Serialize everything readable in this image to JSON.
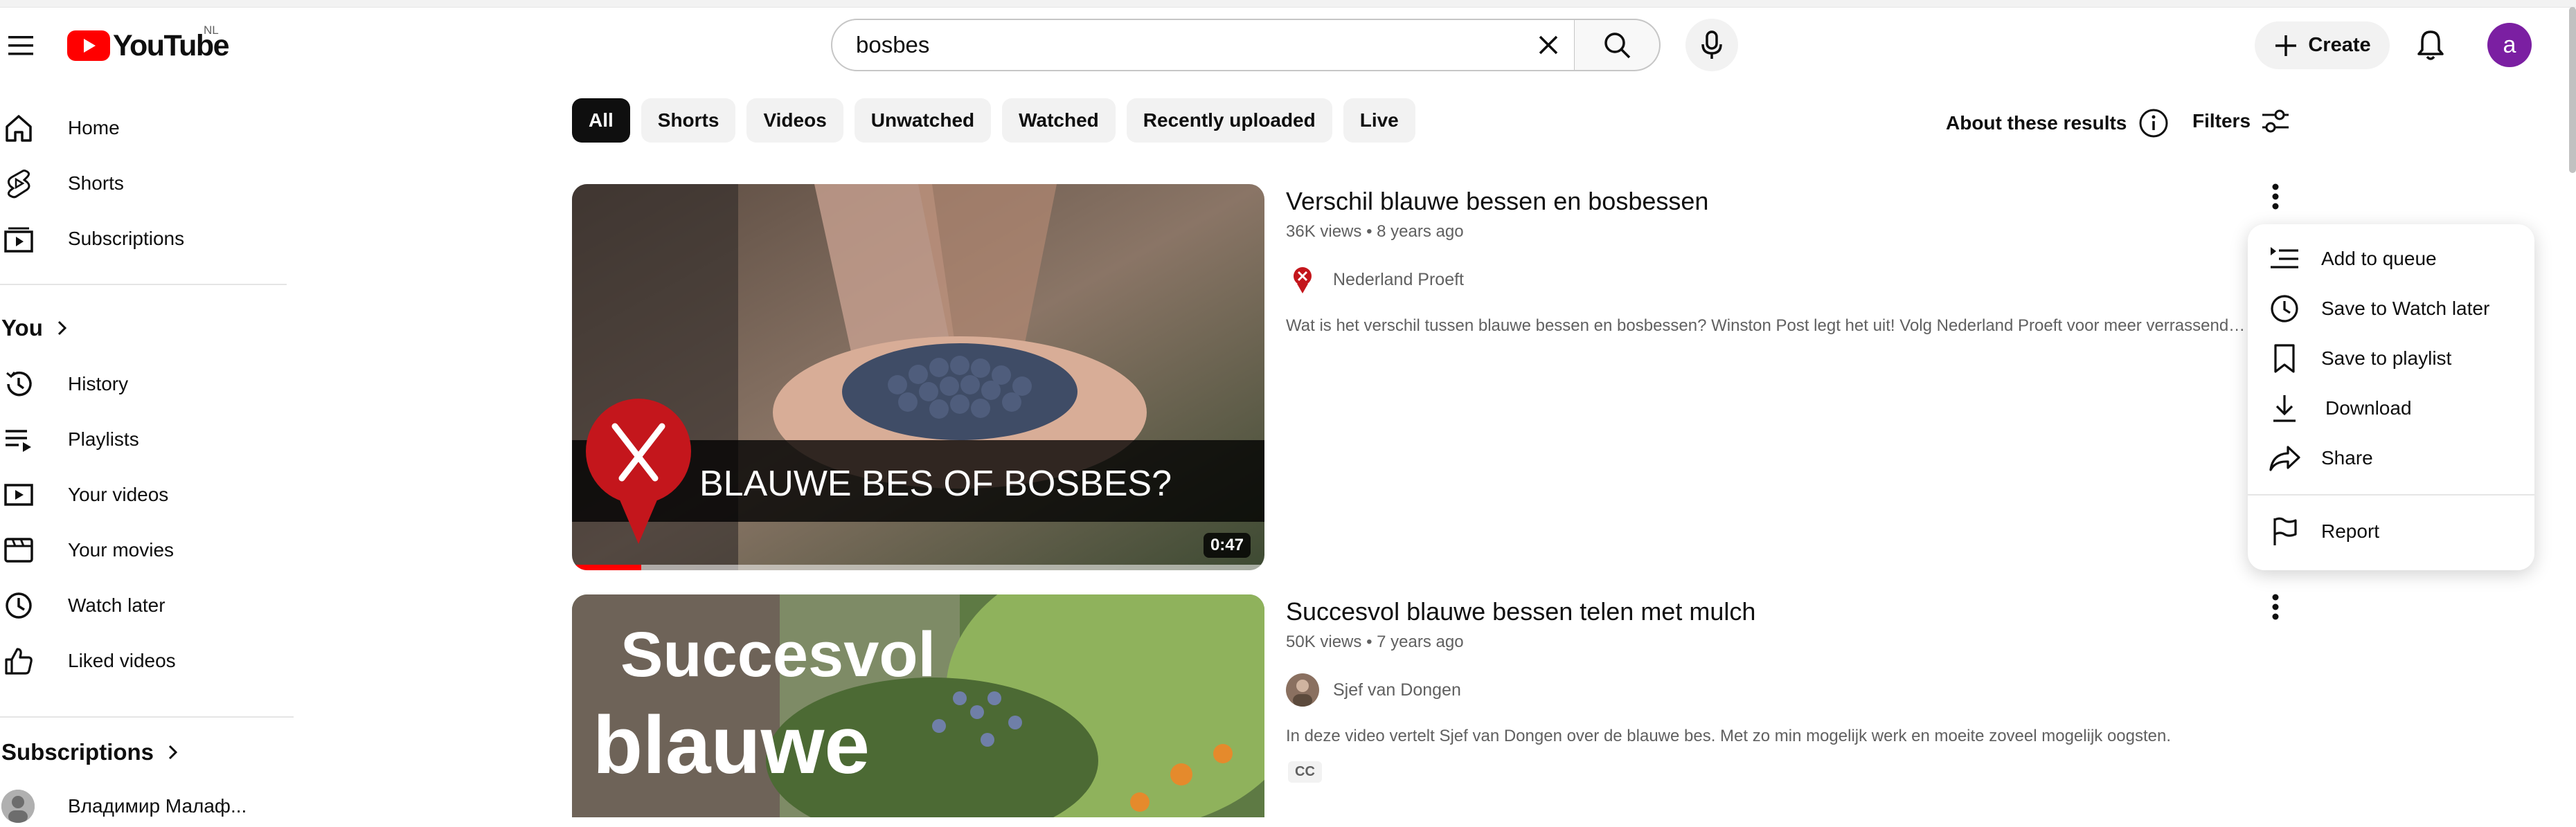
{
  "header": {
    "logo_text": "YouTube",
    "country_code": "NL",
    "search_value": "bosbes",
    "create_label": "Create",
    "avatar_letter": "a"
  },
  "sidebar": {
    "main": [
      {
        "label": "Home",
        "icon": "home-icon"
      },
      {
        "label": "Shorts",
        "icon": "shorts-icon"
      },
      {
        "label": "Subscriptions",
        "icon": "subscriptions-icon"
      }
    ],
    "you_heading": "You",
    "you_items": [
      {
        "label": "History",
        "icon": "history-icon"
      },
      {
        "label": "Playlists",
        "icon": "playlists-icon"
      },
      {
        "label": "Your videos",
        "icon": "your-videos-icon"
      },
      {
        "label": "Your movies",
        "icon": "movies-icon"
      },
      {
        "label": "Watch later",
        "icon": "clock-icon"
      },
      {
        "label": "Liked videos",
        "icon": "thumbs-up-icon"
      }
    ],
    "subscriptions_heading": "Subscriptions",
    "subscriptions": [
      {
        "label": "Владимир Малаф..."
      }
    ]
  },
  "chips": [
    "All",
    "Shorts",
    "Videos",
    "Unwatched",
    "Watched",
    "Recently uploaded",
    "Live"
  ],
  "active_chip": "All",
  "about_label": "About these results",
  "filters_label": "Filters",
  "results": [
    {
      "title": "Verschil blauwe bessen en bosbessen",
      "views": "36K views",
      "age": "8 years ago",
      "channel": "Nederland Proeft",
      "description": "Wat is het verschil tussen blauwe bessen en bosbessen? Winston Post legt het uit! Volg Nederland Proeft voor meer verrassende ...",
      "thumbnail_caption": "BLAUWE BES OF BOSBES?",
      "duration": "0:47",
      "watch_progress_percent": 10
    },
    {
      "title": "Succesvol blauwe bessen telen met mulch",
      "views": "50K views",
      "age": "7 years ago",
      "channel": "Sjef van Dongen",
      "description": "In deze video vertelt Sjef van Dongen over de blauwe bes. Met zo min mogelijk werk en moeite zoveel mogelijk oogsten.",
      "badge": "CC",
      "thumbnail_caption_1": "Succesvol",
      "thumbnail_caption_2": "blauwe"
    }
  ],
  "context_menu": {
    "items": [
      {
        "label": "Add to queue",
        "icon": "add-to-queue-icon"
      },
      {
        "label": "Save to Watch later",
        "icon": "clock-icon"
      },
      {
        "label": "Save to playlist",
        "icon": "bookmark-icon"
      },
      {
        "label": "Download",
        "icon": "download-icon"
      },
      {
        "label": "Share",
        "icon": "share-icon"
      },
      {
        "label": "Report",
        "icon": "flag-icon"
      }
    ]
  },
  "colors": {
    "brand_red": "#ff0000",
    "avatar_bg": "#7b1fa2",
    "chip_active_bg": "#0f0f0f",
    "chip_bg": "#f2f2f2"
  }
}
